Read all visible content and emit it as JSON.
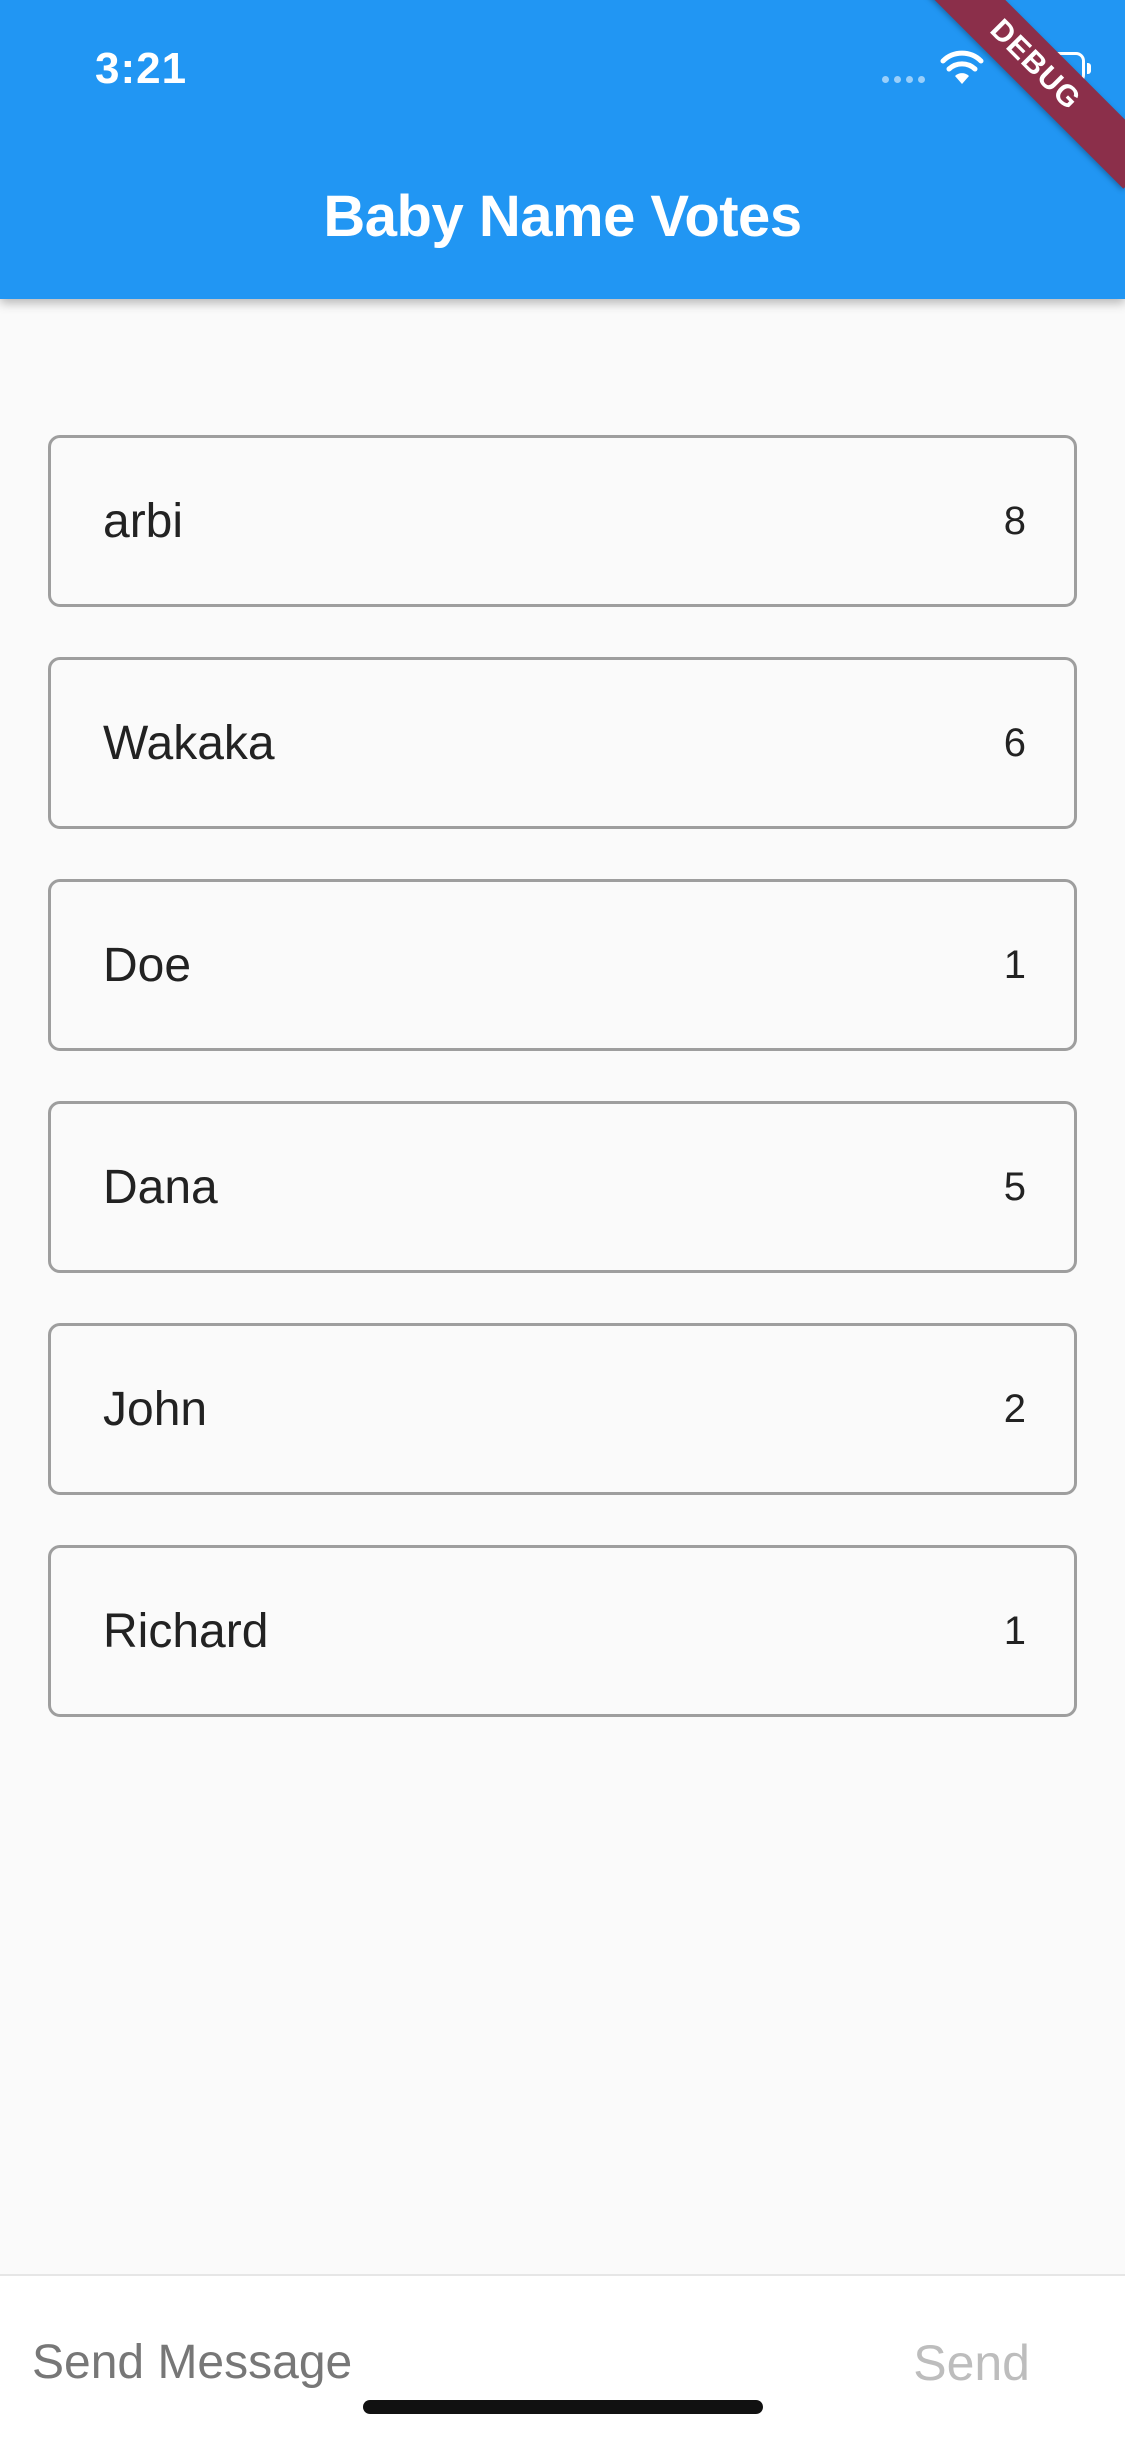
{
  "status_bar": {
    "time": "3:21"
  },
  "app_bar": {
    "title": "Baby Name Votes"
  },
  "debug_banner": "DEBUG",
  "names": [
    {
      "name": "arbi",
      "votes": "8"
    },
    {
      "name": "Wakaka",
      "votes": "6"
    },
    {
      "name": "Doe",
      "votes": "1"
    },
    {
      "name": "Dana",
      "votes": "5"
    },
    {
      "name": "John",
      "votes": "2"
    },
    {
      "name": "Richard",
      "votes": "1"
    }
  ],
  "composer": {
    "placeholder": "Send Message",
    "send_label": "Send"
  },
  "colors": {
    "app_bar": "#2196f3",
    "debug_banner": "#8b2f4a"
  }
}
